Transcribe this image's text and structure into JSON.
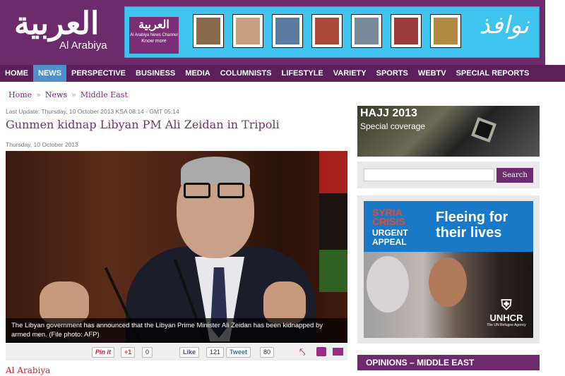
{
  "logo": {
    "arabic": "العربية",
    "english": "Al Arabiya"
  },
  "banner": {
    "channel_logo": "العربية",
    "channel_name": "Al Arabiya News Channel",
    "know_more": "Know more",
    "script_text": "نوافذ",
    "paintings": [
      "#8a6a4a",
      "#c8a080",
      "#5a7aa0",
      "#aa4a3a",
      "#7a8a9a",
      "#9a3a3a",
      "#b08a40"
    ]
  },
  "nav": {
    "items": [
      "HOME",
      "NEWS",
      "PERSPECTIVE",
      "BUSINESS",
      "MEDIA",
      "COLUMNISTS",
      "LIFESTYLE",
      "VARIETY",
      "SPORTS",
      "WEBTV",
      "SPECIAL REPORTS"
    ],
    "active": "NEWS"
  },
  "breadcrumb": {
    "home": "Home",
    "news": "News",
    "section": "Middle East",
    "separator": "»"
  },
  "article": {
    "last_update": "Last Update: Thursday, 10 October 2013 KSA 08:14 - GMT 05:14",
    "title": "Gunmen kidnap Libyan PM Ali Zeidan in Tripoli",
    "date": "Thursday, 10 October 2013",
    "caption": "The Libyan government has announced that the Libyan Prime Minister Ali Zeidan has been kidnapped by armed men. (File photo: AFP)",
    "source": "Al Arabiya"
  },
  "share": {
    "pinit": "Pin it",
    "gplus": "+1",
    "gplus_count": "0",
    "fb_like": "Like",
    "fb_count": "121",
    "tweet": "Tweet",
    "tweet_count": "80"
  },
  "hajj": {
    "title": "HAJJ 2013",
    "subtitle": "Special coverage"
  },
  "search": {
    "placeholder": "",
    "button": "Search"
  },
  "unhcr_ad": {
    "syria": "SYRIA CRISIS",
    "urgent": "URGENT APPEAL",
    "headline": "Fleeing for their lives",
    "org": "UNHCR",
    "org_sub": "The UN Refugee Agency"
  },
  "opinions": {
    "title": "OPINIONS – MIDDLE EAST"
  },
  "colors": {
    "brand_purple": "#6b2b6c",
    "nav_active": "#4f8fcc",
    "title_purple": "#7b2d7b"
  }
}
